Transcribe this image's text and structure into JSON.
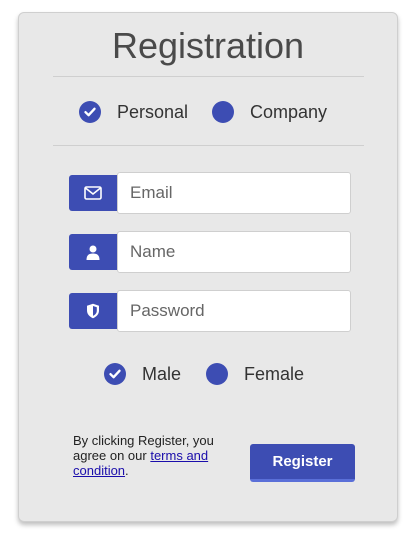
{
  "title": "Registration",
  "account_type": {
    "options": [
      {
        "label": "Personal",
        "selected": true
      },
      {
        "label": "Company",
        "selected": false
      }
    ]
  },
  "fields": {
    "email": {
      "placeholder": "Email",
      "value": "",
      "icon": "envelope-icon"
    },
    "name": {
      "placeholder": "Name",
      "value": "",
      "icon": "user-icon"
    },
    "password": {
      "placeholder": "Password",
      "value": "",
      "icon": "shield-icon"
    }
  },
  "gender": {
    "options": [
      {
        "label": "Male",
        "selected": true
      },
      {
        "label": "Female",
        "selected": false
      }
    ]
  },
  "terms": {
    "prefix": "By clicking Register, you agree on our ",
    "link": "terms and condition",
    "suffix": "."
  },
  "register_label": "Register",
  "colors": {
    "accent": "#3d4db3",
    "card_bg": "#e8e8e8",
    "link": "#1a0dab"
  }
}
